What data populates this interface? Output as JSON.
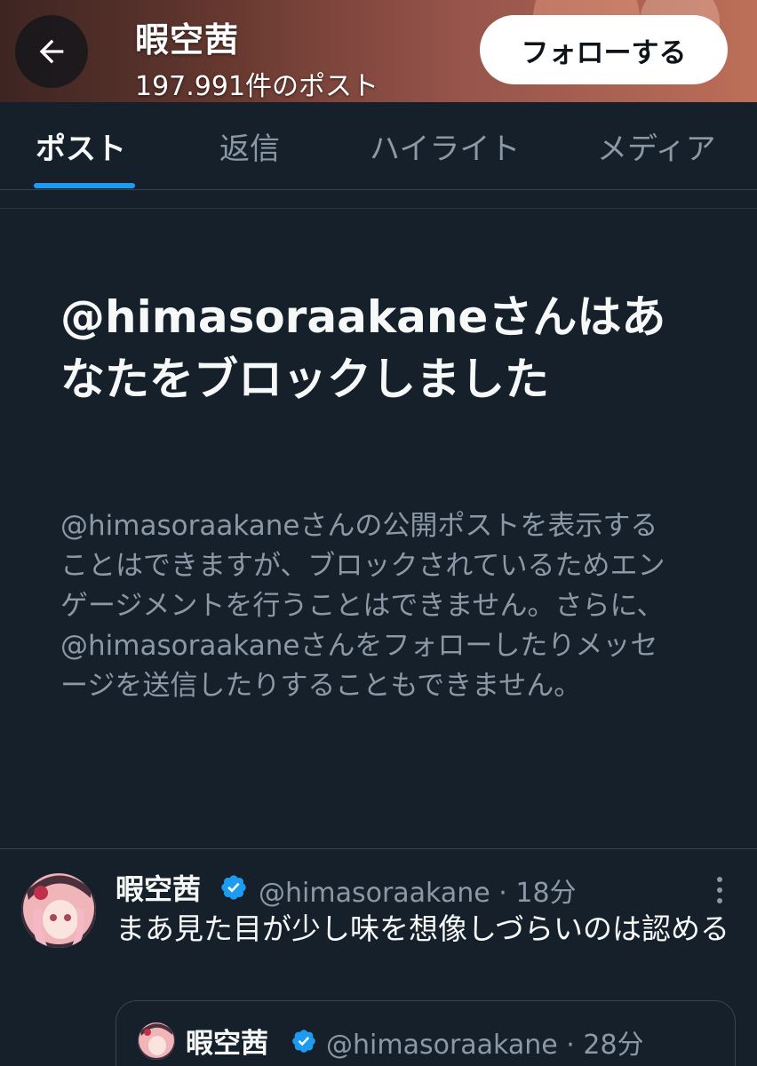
{
  "header": {
    "name": "暇空茜",
    "post_count": "197.991件のポスト",
    "follow_label": "フォローする"
  },
  "tabs": [
    {
      "label": "ポスト",
      "active": true
    },
    {
      "label": "返信",
      "active": false
    },
    {
      "label": "ハイライト",
      "active": false
    },
    {
      "label": "メディア",
      "active": false
    }
  ],
  "blocked": {
    "title": "@himasoraakaneさんはあなたをブロックしました",
    "description": "@himasoraakaneさんの公開ポストを表示することはできますが、ブロックされているためエンゲージメントを行うことはできません。さらに、@himasoraakaneさんをフォローしたりメッセージを送信したりすることもできません。"
  },
  "post": {
    "name": "暇空茜",
    "handle_time": "@himasoraakane · 18分",
    "text": "まあ見た目が少し味を想像しづらいのは認める",
    "quote": {
      "name": "暇空茜",
      "handle_time": "@himasoraakane · 28分"
    }
  },
  "colors": {
    "background": "#15202b",
    "accent": "#1d9bf0",
    "secondary_text": "#8b98a5",
    "border": "#38444d"
  },
  "icons": [
    "back-arrow-icon",
    "verified-badge-icon",
    "more-options-icon"
  ]
}
